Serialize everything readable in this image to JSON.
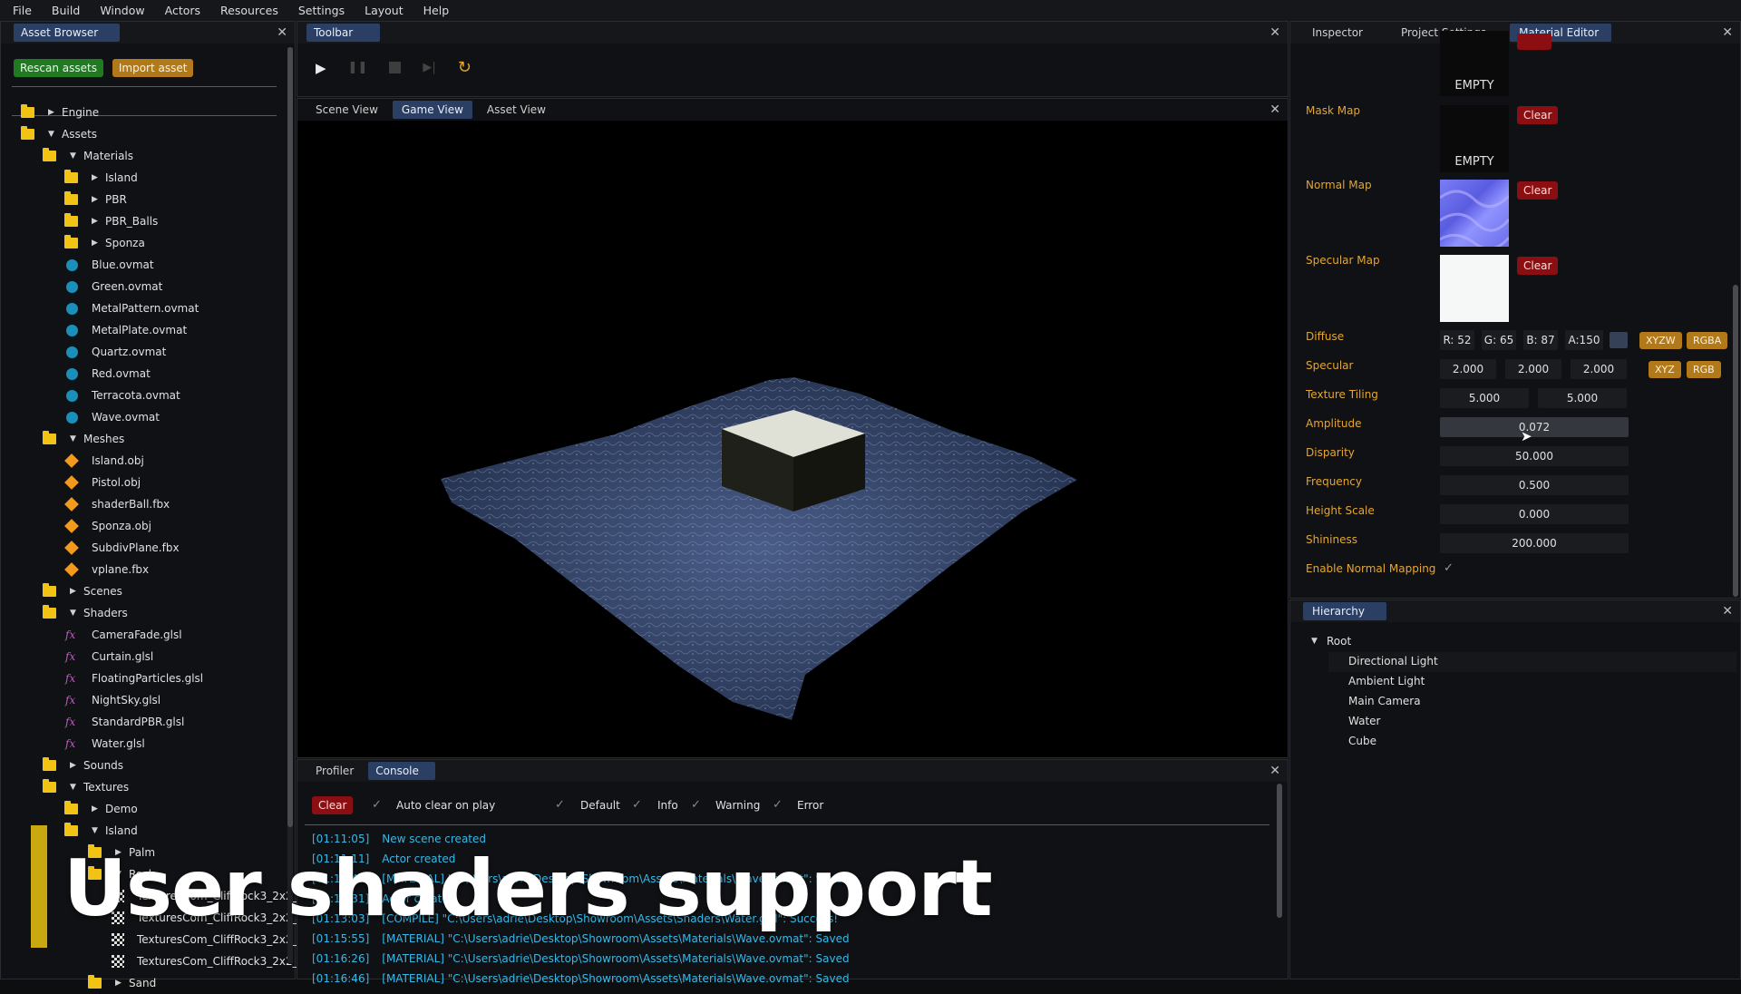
{
  "menu": [
    "File",
    "Build",
    "Window",
    "Actors",
    "Resources",
    "Settings",
    "Layout",
    "Help"
  ],
  "asset_browser": {
    "tab": "Asset Browser",
    "rescan": "Rescan assets",
    "import": "Import asset",
    "rows": [
      {
        "t": "Engine",
        "k": "folder",
        "d": 0,
        "c": "right"
      },
      {
        "t": "Assets",
        "k": "folder",
        "d": 0,
        "c": "down"
      },
      {
        "t": "Materials",
        "k": "folder",
        "d": 1,
        "c": "down"
      },
      {
        "t": "Island",
        "k": "folder",
        "d": 2,
        "c": "right"
      },
      {
        "t": "PBR",
        "k": "folder",
        "d": 2,
        "c": "right"
      },
      {
        "t": "PBR_Balls",
        "k": "folder",
        "d": 2,
        "c": "right"
      },
      {
        "t": "Sponza",
        "k": "folder",
        "d": 2,
        "c": "right"
      },
      {
        "t": "Blue.ovmat",
        "k": "mat",
        "d": 2
      },
      {
        "t": "Green.ovmat",
        "k": "mat",
        "d": 2
      },
      {
        "t": "MetalPattern.ovmat",
        "k": "mat",
        "d": 2
      },
      {
        "t": "MetalPlate.ovmat",
        "k": "mat",
        "d": 2
      },
      {
        "t": "Quartz.ovmat",
        "k": "mat",
        "d": 2
      },
      {
        "t": "Red.ovmat",
        "k": "mat",
        "d": 2
      },
      {
        "t": "Terracota.ovmat",
        "k": "mat",
        "d": 2
      },
      {
        "t": "Wave.ovmat",
        "k": "mat",
        "d": 2
      },
      {
        "t": "Meshes",
        "k": "folder",
        "d": 1,
        "c": "down"
      },
      {
        "t": "Island.obj",
        "k": "mesh",
        "d": 2
      },
      {
        "t": "Pistol.obj",
        "k": "mesh",
        "d": 2
      },
      {
        "t": "shaderBall.fbx",
        "k": "mesh",
        "d": 2
      },
      {
        "t": "Sponza.obj",
        "k": "mesh",
        "d": 2
      },
      {
        "t": "SubdivPlane.fbx",
        "k": "mesh",
        "d": 2
      },
      {
        "t": "vplane.fbx",
        "k": "mesh",
        "d": 2
      },
      {
        "t": "Scenes",
        "k": "folder",
        "d": 1,
        "c": "right"
      },
      {
        "t": "Shaders",
        "k": "folder",
        "d": 1,
        "c": "down"
      },
      {
        "t": "CameraFade.glsl",
        "k": "shader",
        "d": 2
      },
      {
        "t": "Curtain.glsl",
        "k": "shader",
        "d": 2
      },
      {
        "t": "FloatingParticles.glsl",
        "k": "shader",
        "d": 2
      },
      {
        "t": "NightSky.glsl",
        "k": "shader",
        "d": 2
      },
      {
        "t": "StandardPBR.glsl",
        "k": "shader",
        "d": 2
      },
      {
        "t": "Water.glsl",
        "k": "shader",
        "d": 2
      },
      {
        "t": "Sounds",
        "k": "folder",
        "d": 1,
        "c": "right"
      },
      {
        "t": "Textures",
        "k": "folder",
        "d": 1,
        "c": "down"
      },
      {
        "t": "Demo",
        "k": "folder",
        "d": 2,
        "c": "right"
      },
      {
        "t": "Island",
        "k": "folder",
        "d": 2,
        "c": "down"
      },
      {
        "t": "Palm",
        "k": "folder",
        "d": 3,
        "c": "right"
      },
      {
        "t": "Rock",
        "k": "folder",
        "d": 3,
        "c": "down"
      },
      {
        "t": "TexturesCom_CliffRock3_2x2_",
        "k": "tex",
        "d": 4
      },
      {
        "t": "TexturesCom_CliffRock3_2x2_",
        "k": "tex",
        "d": 4
      },
      {
        "t": "TexturesCom_CliffRock3_2x2_",
        "k": "tex",
        "d": 4
      },
      {
        "t": "TexturesCom_CliffRock3_2x2_",
        "k": "tex",
        "d": 4
      },
      {
        "t": "Sand",
        "k": "folder",
        "d": 3,
        "c": "right"
      }
    ]
  },
  "toolbar": {
    "tab": "Toolbar"
  },
  "views": {
    "tabs": [
      "Scene View",
      "Game View",
      "Asset View"
    ],
    "active": 1
  },
  "bottom": {
    "tabs": [
      "Profiler",
      "Console"
    ],
    "active": 1,
    "clear": "Clear",
    "auto_clear": "Auto clear on play",
    "filters": [
      "Default",
      "Info",
      "Warning",
      "Error"
    ],
    "log": [
      {
        "ts": "[01:11:05]",
        "msg": "New scene created"
      },
      {
        "ts": "[01:11:11]",
        "msg": "Actor created"
      },
      {
        "ts": "[01:11:47]",
        "msg": "[MATERIAL] \"C:\\Users\\adrie\\Desktop\\Showroom\\Assets\\Materials\\Wave.ovmat\": Saved"
      },
      {
        "ts": "[01:12:31]",
        "msg": "Actor created"
      },
      {
        "ts": "[01:13:03]",
        "msg": "[COMPILE] \"C:\\Users\\adrie\\Desktop\\Showroom\\Assets\\Shaders\\Water.glsl\": Success!"
      },
      {
        "ts": "[01:15:55]",
        "msg": "[MATERIAL] \"C:\\Users\\adrie\\Desktop\\Showroom\\Assets\\Materials\\Wave.ovmat\": Saved"
      },
      {
        "ts": "[01:16:26]",
        "msg": "[MATERIAL] \"C:\\Users\\adrie\\Desktop\\Showroom\\Assets\\Materials\\Wave.ovmat\": Saved"
      },
      {
        "ts": "[01:16:46]",
        "msg": "[MATERIAL] \"C:\\Users\\adrie\\Desktop\\Showroom\\Assets\\Materials\\Wave.ovmat\": Saved"
      }
    ]
  },
  "right_tabs": [
    "Inspector",
    "Project Settings",
    "Material Editor"
  ],
  "material": {
    "empty": "EMPTY",
    "clear": "Clear",
    "mask_map": "Mask Map",
    "normal_map": "Normal Map",
    "specular_map": "Specular Map",
    "diffuse": {
      "label": "Diffuse",
      "r": "R: 52",
      "g": "G: 65",
      "b": "B: 87",
      "a": "A:150",
      "btn1": "XYZW",
      "btn2": "RGBA",
      "swatch": "#344157"
    },
    "specular": {
      "label": "Specular",
      "x": "2.000",
      "y": "2.000",
      "z": "2.000",
      "btn1": "XYZ",
      "btn2": "RGB"
    },
    "tiling": {
      "label": "Texture Tiling",
      "x": "5.000",
      "y": "5.000"
    },
    "amplitude": {
      "label": "Amplitude",
      "v": "0.072"
    },
    "disparity": {
      "label": "Disparity",
      "v": "50.000"
    },
    "frequency": {
      "label": "Frequency",
      "v": "0.500"
    },
    "height": {
      "label": "Height Scale",
      "v": "0.000"
    },
    "shininess": {
      "label": "Shininess",
      "v": "200.000"
    },
    "normal_mapping": {
      "label": "Enable Normal Mapping"
    }
  },
  "hierarchy": {
    "tab": "Hierarchy",
    "root": "Root",
    "items": [
      "Directional Light",
      "Ambient Light",
      "Main Camera",
      "Water",
      "Cube"
    ]
  },
  "overlay": {
    "text": "User shaders support"
  }
}
